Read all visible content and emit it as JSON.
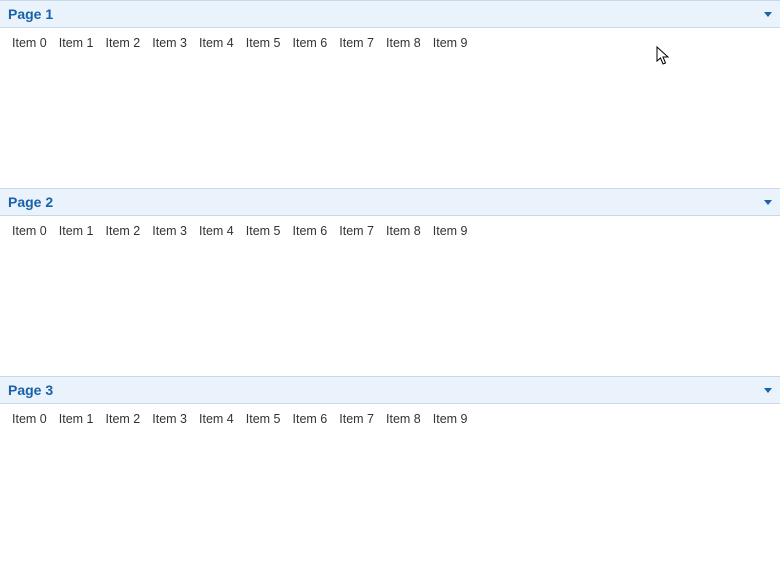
{
  "panels": [
    {
      "title": "Page 1",
      "items": [
        "Item 0",
        "Item 1",
        "Item 2",
        "Item 3",
        "Item 4",
        "Item 5",
        "Item 6",
        "Item 7",
        "Item 8",
        "Item 9"
      ]
    },
    {
      "title": "Page 2",
      "items": [
        "Item 0",
        "Item 1",
        "Item 2",
        "Item 3",
        "Item 4",
        "Item 5",
        "Item 6",
        "Item 7",
        "Item 8",
        "Item 9"
      ]
    },
    {
      "title": "Page 3",
      "items": [
        "Item 0",
        "Item 1",
        "Item 2",
        "Item 3",
        "Item 4",
        "Item 5",
        "Item 6",
        "Item 7",
        "Item 8",
        "Item 9"
      ]
    }
  ]
}
